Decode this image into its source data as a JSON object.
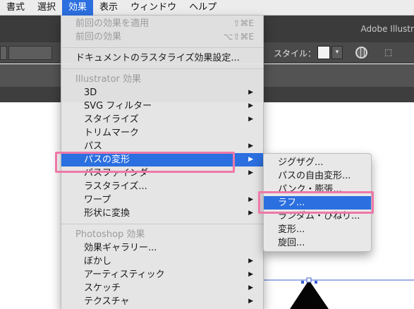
{
  "menubar": {
    "items": [
      {
        "label": "書式"
      },
      {
        "label": "選択"
      },
      {
        "label": "効果",
        "active": true
      },
      {
        "label": "表示"
      },
      {
        "label": "ウィンドウ"
      },
      {
        "label": "ヘルプ"
      }
    ]
  },
  "app": {
    "title": "Adobe Illustr",
    "control_bar": {
      "style_label": "スタイル："
    }
  },
  "effect_menu": {
    "apply_last": {
      "label": "前回の効果を適用",
      "shortcut": "⇧⌘E"
    },
    "last_effect": {
      "label": "前回の効果",
      "shortcut": "⌥⇧⌘E"
    },
    "document_raster": {
      "label": "ドキュメントのラスタライズ効果設定..."
    },
    "illustrator_header": "Illustrator 効果",
    "illustrator_items": [
      {
        "label": "3D",
        "submenu": true
      },
      {
        "label": "SVG フィルター",
        "submenu": true
      },
      {
        "label": "スタイライズ",
        "submenu": true
      },
      {
        "label": "トリムマーク",
        "submenu": false
      },
      {
        "label": "パス",
        "submenu": true
      },
      {
        "label": "パスの変形",
        "submenu": true,
        "highlighted": true
      },
      {
        "label": "パスファインダー",
        "submenu": true
      },
      {
        "label": "ラスタライズ...",
        "submenu": false
      },
      {
        "label": "ワープ",
        "submenu": true
      },
      {
        "label": "形状に変換",
        "submenu": true
      }
    ],
    "photoshop_header": "Photoshop 効果",
    "photoshop_items": [
      {
        "label": "効果ギャラリー...",
        "submenu": false
      },
      {
        "label": "ぼかし",
        "submenu": true
      },
      {
        "label": "アーティスティック",
        "submenu": true
      },
      {
        "label": "スケッチ",
        "submenu": true
      },
      {
        "label": "テクスチャ",
        "submenu": true
      }
    ]
  },
  "distort_submenu": {
    "items": [
      {
        "label": "ジグザグ..."
      },
      {
        "label": "パスの自由変形..."
      },
      {
        "label": "パンク・膨張..."
      },
      {
        "label": "ラフ...",
        "highlighted": true
      },
      {
        "label": "ランダム・ひねり..."
      },
      {
        "label": "変形..."
      },
      {
        "label": "旋回..."
      }
    ]
  },
  "colors": {
    "highlight": "#2b6fe0",
    "annotation": "#ef78a8"
  },
  "icons": {
    "submenu_arrow": "▶",
    "control_chevron": "›",
    "dropdown_chevron": "▾",
    "transform_icon": "⬚",
    "globe": "globe-icon"
  }
}
